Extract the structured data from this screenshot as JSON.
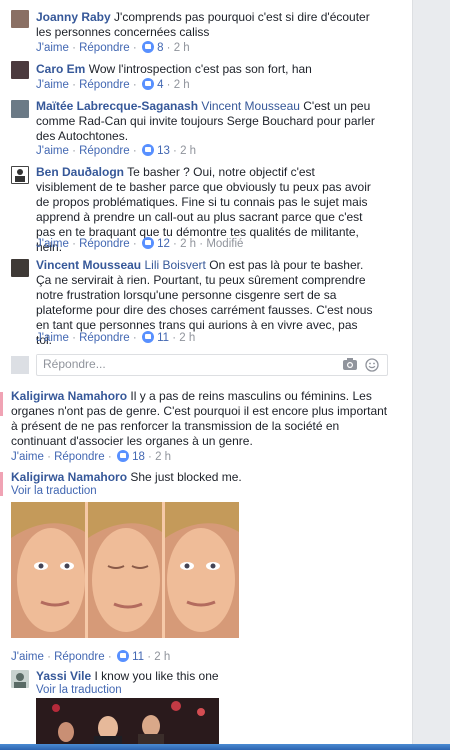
{
  "actions": {
    "like": "J'aime",
    "reply": "Répondre",
    "sep": " · ",
    "modified": "Modifié"
  },
  "comments": [
    {
      "name": "Joanny Raby",
      "tag": "",
      "text": "J'comprends pas pourquoi c'est si dire d'écouter les personnes concernées caliss",
      "count": "8",
      "time": "2 h"
    },
    {
      "name": "Caro Em",
      "tag": "",
      "text": "Wow l'introspection c'est pas son fort, han",
      "count": "4",
      "time": "2 h"
    },
    {
      "name": "Maïtée Labrecque-Saganash",
      "tag": "Vincent Mousseau",
      "text": "C'est un peu comme Rad-Can qui invite toujours Serge Bouchard pour parler des Autochtones.",
      "count": "13",
      "time": "2 h"
    },
    {
      "name": "Ben Dauðalogn",
      "tag": "",
      "text": "Te basher ? Oui, notre objectif c'est visiblement de te basher parce que obviously tu peux pas avoir de propos problématiques. Fine si tu connais pas le sujet mais apprend à prendre un call-out au plus sacrant parce que c'est pas en te braquant que tu démontre tes qualités de militante, hein.",
      "count": "12",
      "time": "2 h"
    },
    {
      "name": "Vincent Mousseau",
      "tag": "Lili Boisvert",
      "text": "On est pas là pour te basher. Ça ne servirait à rien. Pourtant, tu peux sûrement comprendre notre frustration lorsqu'une personne cisgenre sert de sa plateforme pour dire des choses carrément fausses. C'est nous en tant que personnes trans qui aurions à en vivre avec, pas toi.",
      "count": "11",
      "time": "2 h"
    },
    {
      "name": "Kaligirwa Namahoro",
      "tag": "",
      "text": "Il y a pas de reins masculins ou féminins. Les organes n'ont pas de genre. C'est pourquoi il est encore plus important à présent de ne pas renforcer la transmission de la société en continuant d'associer les organes à un genre.",
      "count": "18",
      "time": "2 h"
    },
    {
      "name": "Kaligirwa Namahoro",
      "tag": "",
      "text": "She just blocked me.",
      "translate": "Voir la traduction",
      "count": "11",
      "time": "2 h"
    },
    {
      "name": "Yassi Vile",
      "tag": "",
      "text": "I know you like this one",
      "translate": "Voir la traduction"
    }
  ],
  "reply_placeholder": "Répondre...",
  "colors": {
    "name": "#365899",
    "link": "#4267b2",
    "meta": "#90949c",
    "badge": "#5890ff"
  }
}
